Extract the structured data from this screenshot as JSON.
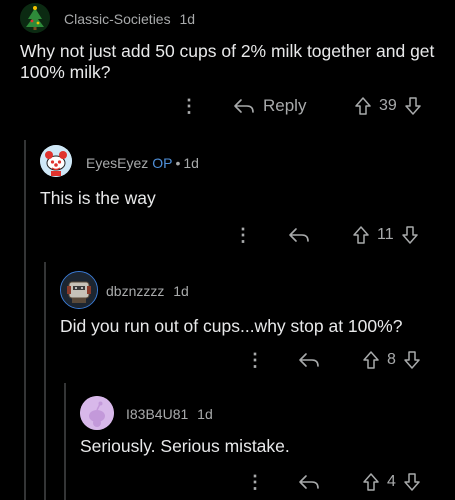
{
  "comments": [
    {
      "username": "Classic-Societies",
      "age": "1d",
      "op": "",
      "body": "Why not just add 50 cups of 2% milk together and get 100% milk?",
      "reply_label": "Reply",
      "score": "39",
      "avatar_icon": "christmas-tree-icon"
    },
    {
      "username": "EyesEyez",
      "age": "1d",
      "op": "OP",
      "body": "This is the way",
      "reply_label": "",
      "score": "11",
      "avatar_icon": "snoo-clown-icon"
    },
    {
      "username": "dbznzzzz",
      "age": "1d",
      "op": "",
      "body": "Did you run out of cups...why stop at 100%?",
      "reply_label": "",
      "score": "8",
      "avatar_icon": "snoo-armor-icon"
    },
    {
      "username": "I83B4U81",
      "age": "1d",
      "op": "",
      "body": "Seriously. Serious mistake.",
      "reply_label": "",
      "score": "4",
      "avatar_icon": "default-snoo-icon"
    }
  ],
  "colors": {
    "background": "#000000",
    "text": "#e8e9ea",
    "muted": "#a8aaab",
    "op": "#4f8fd8",
    "thread_line": "#343536"
  }
}
